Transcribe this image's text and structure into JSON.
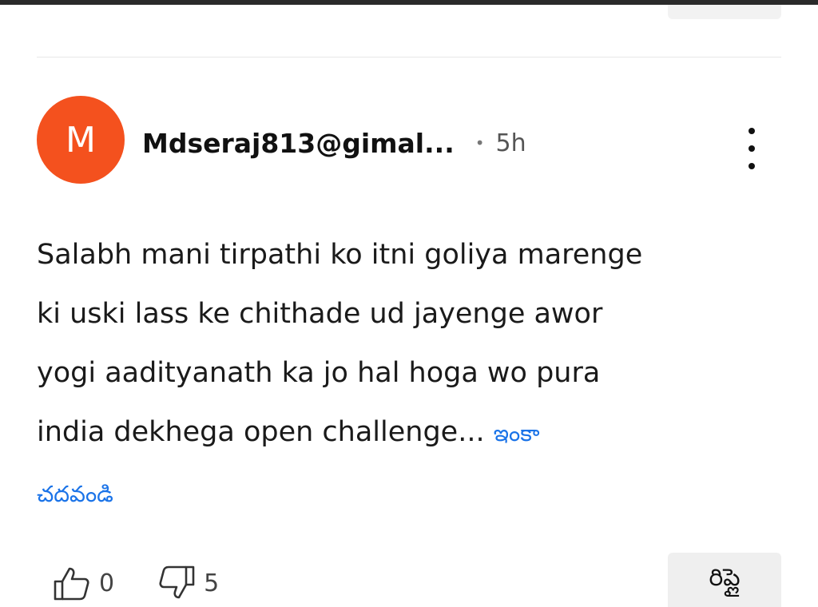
{
  "comment": {
    "avatar_letter": "M",
    "avatar_color": "#f4511e",
    "username": "Mdseraj813@gimal...",
    "separator": "•",
    "time": "5h",
    "more_icon": "more-vert-icon",
    "text_lines": [
      "Salabh mani tirpathi ko itni goliya marenge",
      "ki uski lass ke chithade ud jayenge awor",
      "yogi aadityanath ka jo hal hoga wo pura",
      "india dekhega open challenge..."
    ],
    "read_more_part1": "ఇంకా",
    "read_more_part2": "చదవండి",
    "read_more_color": "#1a73e8",
    "likes": "0",
    "dislikes": "5",
    "like_icon": "thumbs-up-icon",
    "dislike_icon": "thumbs-down-icon",
    "reply_label": "రిప్లై"
  }
}
